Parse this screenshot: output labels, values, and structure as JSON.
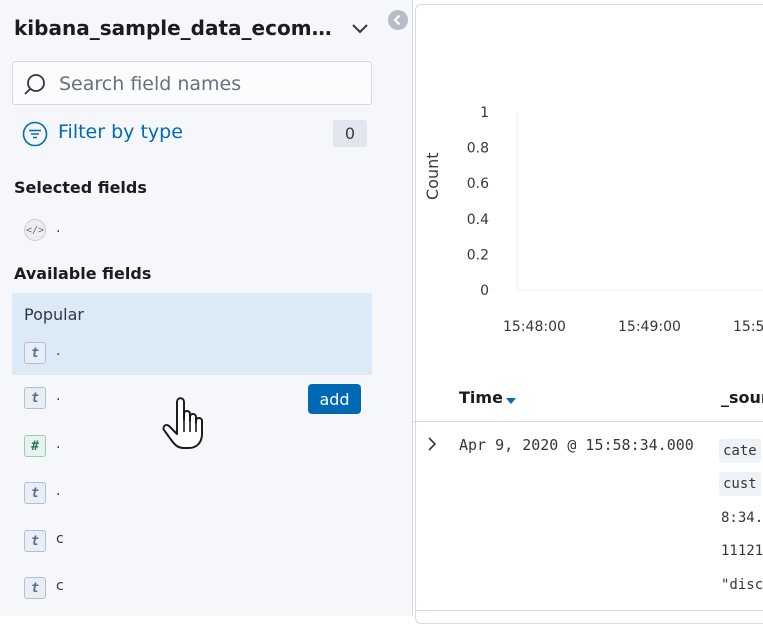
{
  "sidebar": {
    "index_pattern": "kibana_sample_data_ecomm...",
    "search_placeholder": "Search field names",
    "filter": {
      "label": "Filter by type",
      "count": "0"
    },
    "selected_title": "Selected fields",
    "selected_fields": [
      {
        "type": "source",
        "token": "</>",
        "name": "."
      }
    ],
    "available_title": "Available fields",
    "popular_label": "Popular",
    "popular_fields": [
      {
        "type": "string",
        "token": "t",
        "name": "."
      }
    ],
    "fields": [
      {
        "type": "string",
        "token": "t",
        "name": "."
      },
      {
        "type": "number",
        "token": "#",
        "name": "."
      },
      {
        "type": "string",
        "token": "t",
        "name": "."
      },
      {
        "type": "string",
        "token": "t",
        "name": "c"
      },
      {
        "type": "string",
        "token": "t",
        "name": "c"
      }
    ],
    "add_label": "add"
  },
  "chart_data": {
    "type": "bar",
    "ylabel": "Count",
    "yticks": [
      "1",
      "0.8",
      "0.6",
      "0.4",
      "0.2",
      "0"
    ],
    "xticks": [
      "15:48:00",
      "15:49:00",
      "15:5"
    ],
    "ylim": [
      0,
      1
    ],
    "values": []
  },
  "table": {
    "time_header": "Time",
    "source_header": "_sour",
    "rows": [
      {
        "time": "Apr 9, 2020 @ 15:58:34.000",
        "chips": [
          "cate",
          "cust"
        ],
        "lines": [
          "8:34.",
          "11121",
          "\"disc"
        ]
      }
    ]
  },
  "colors": {
    "accent": "#006bb8",
    "button": "#0069b4",
    "popular_bg": "#dceaf7"
  }
}
